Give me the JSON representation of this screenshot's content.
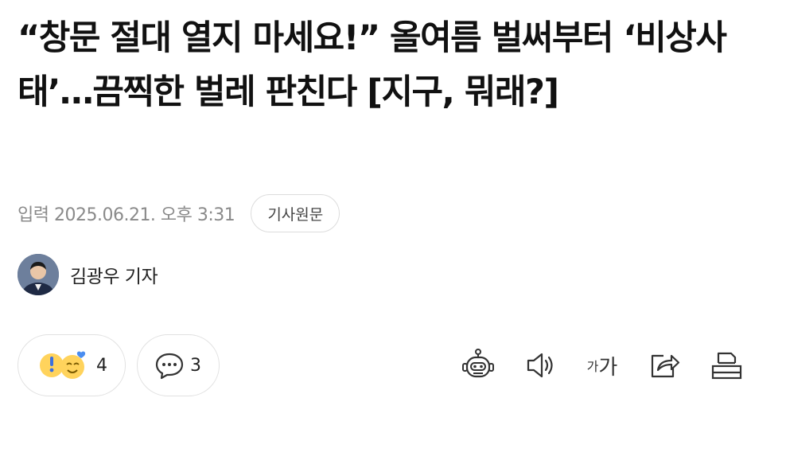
{
  "article": {
    "headline": "“창문 절대 열지 마세요!” 올여름 벌써부터 ‘비상사태’…끔찍한 벌레 판친다 [지구, 뭐래?]",
    "date": "입력 2025.06.21. 오후 3:31",
    "original_button": "기사원문",
    "reporter": "김광우 기자"
  },
  "reactions": {
    "icons": [
      "surprised-emoji-icon",
      "happy-heart-emoji-icon"
    ],
    "count": "4"
  },
  "comments": {
    "icon": "speech-bubble-icon",
    "count": "3"
  },
  "toolbar": {
    "items": [
      "robot-summary-icon",
      "speaker-icon",
      "font-size-icon",
      "share-icon",
      "print-icon"
    ],
    "font_small": "가",
    "font_big": "가"
  },
  "colors": {
    "text": "#111111",
    "meta": "#8a8a8a",
    "border": "#dcdcdc",
    "emoji_yellow": "#ffd35c",
    "heart_blue": "#4a8df0"
  }
}
